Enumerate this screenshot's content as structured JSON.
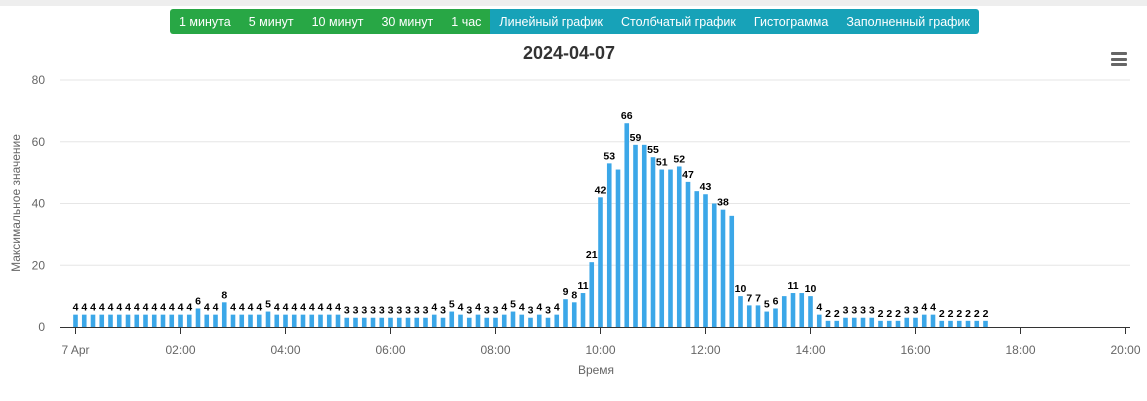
{
  "toolbar": {
    "interval_buttons": [
      "1 минута",
      "5 минут",
      "10 минут",
      "30 минут",
      "1 час"
    ],
    "chart_type_buttons": [
      "Линейный график",
      "Столбчатый график",
      "Гистограмма",
      "Заполненный график"
    ]
  },
  "menu_icon": "hamburger-menu-icon",
  "colors": {
    "bar": "#3ba7e8",
    "interval_button": "#28a745",
    "chart_type_button": "#17a2b8"
  },
  "chart_data": {
    "type": "bar",
    "title": "2024-04-07",
    "xlabel": "Время",
    "ylabel": "Максимальное значение",
    "ylim": [
      0,
      80
    ],
    "yticks": [
      0,
      20,
      40,
      60,
      80
    ],
    "xticks": [
      "7 Apr",
      "02:00",
      "04:00",
      "06:00",
      "08:00",
      "10:00",
      "12:00",
      "14:00",
      "16:00",
      "18:00",
      "20:00"
    ],
    "xlim_hours": [
      0,
      20.33
    ],
    "bar_interval_minutes": 10,
    "grid": true,
    "series": [
      {
        "values": [
          4,
          4,
          4,
          4,
          4,
          4,
          4,
          4,
          4,
          4,
          4,
          4,
          4,
          4,
          6,
          4,
          4,
          8,
          4,
          4,
          4,
          4,
          5,
          4,
          4,
          4,
          4,
          4,
          4,
          4,
          4,
          3,
          3,
          3,
          3,
          3,
          3,
          3,
          3,
          3,
          3,
          4,
          3,
          5,
          4,
          3,
          4,
          3,
          3,
          4,
          5,
          4,
          3,
          4,
          3,
          4,
          9,
          8,
          11,
          21,
          42,
          53,
          51,
          66,
          59,
          59,
          55,
          51,
          51,
          52,
          47,
          44,
          43,
          40,
          38,
          36,
          10,
          7,
          7,
          5,
          6,
          10,
          11,
          11,
          10,
          4,
          2,
          2,
          3,
          3,
          3,
          3,
          2,
          2,
          2,
          3,
          3,
          4,
          4,
          2,
          2,
          2,
          2,
          2,
          2
        ]
      }
    ],
    "data_labels": [
      4,
      4,
      4,
      4,
      4,
      4,
      4,
      4,
      4,
      4,
      4,
      4,
      4,
      4,
      6,
      4,
      4,
      8,
      4,
      4,
      4,
      4,
      5,
      4,
      4,
      4,
      4,
      4,
      4,
      4,
      4,
      3,
      3,
      3,
      3,
      3,
      3,
      3,
      3,
      3,
      3,
      4,
      3,
      5,
      4,
      3,
      4,
      3,
      3,
      4,
      5,
      4,
      3,
      4,
      3,
      4,
      9,
      8,
      11,
      21,
      42,
      53,
      null,
      66,
      59,
      null,
      55,
      51,
      null,
      52,
      47,
      null,
      43,
      null,
      38,
      null,
      10,
      7,
      7,
      5,
      6,
      null,
      11,
      null,
      10,
      4,
      2,
      2,
      3,
      3,
      3,
      3,
      2,
      2,
      2,
      3,
      3,
      4,
      4,
      2,
      2,
      2,
      2,
      2,
      2
    ]
  }
}
